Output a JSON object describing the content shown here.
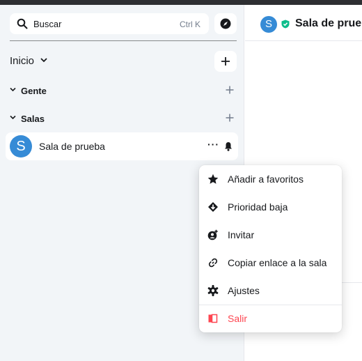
{
  "search": {
    "placeholder": "Buscar",
    "shortcut": "Ctrl K"
  },
  "home": {
    "title": "Inicio"
  },
  "sections": {
    "people": "Gente",
    "rooms": "Salas"
  },
  "room": {
    "avatar": "S",
    "name": "Sala de prueba",
    "more": "···"
  },
  "header": {
    "avatar": "S",
    "title": "Sala de prueba"
  },
  "menu": {
    "favorite": "Añadir a favoritos",
    "low_priority": "Prioridad baja",
    "invite": "Invitar",
    "copy_link": "Copiar enlace a la sala",
    "settings": "Ajustes",
    "leave": "Salir"
  },
  "colors": {
    "accent": "#368bd6",
    "verified": "#0dbd8b",
    "danger": "#fe4550",
    "sidebar_bg": "#f2f5f8"
  }
}
